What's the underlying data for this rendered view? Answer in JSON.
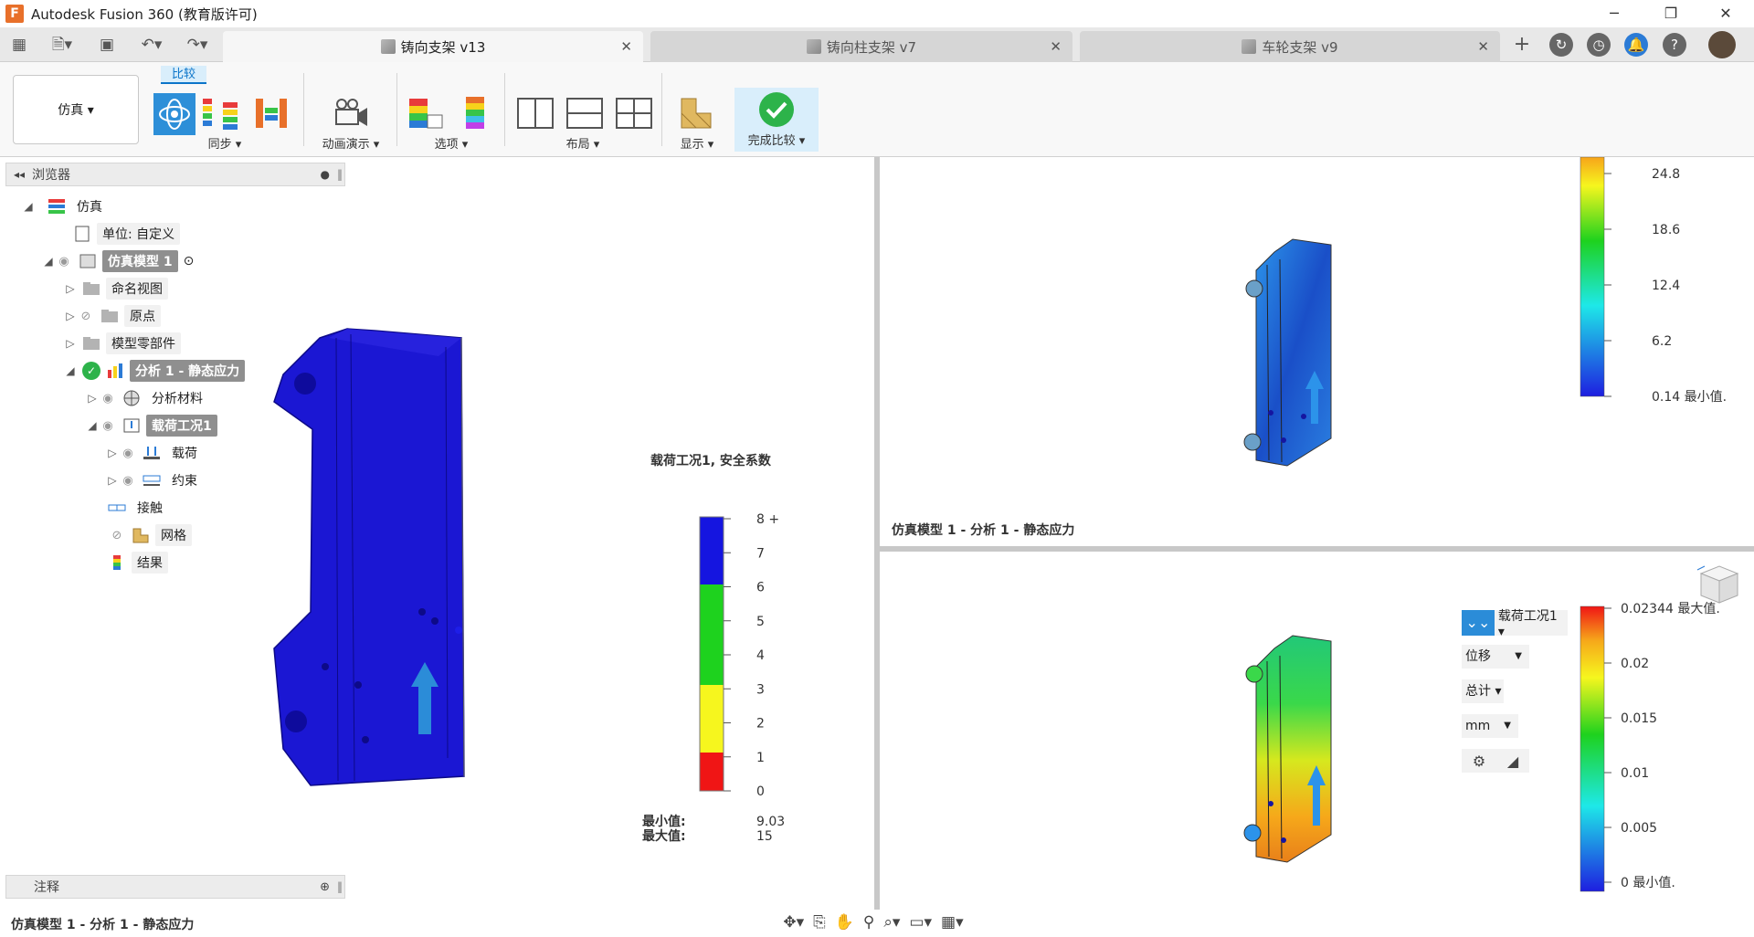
{
  "app": {
    "title": "Autodesk Fusion 360 (教育版许可)"
  },
  "tabs": [
    {
      "label": "铸向支架 v13",
      "active": true
    },
    {
      "label": "铸向柱支架 v7",
      "active": false
    },
    {
      "label": "车轮支架 v9",
      "active": false
    }
  ],
  "ribbon": {
    "workspace": "仿真 ▾",
    "compare_tab": "比较",
    "groups": {
      "sync": "同步 ▾",
      "animation": "动画演示 ▾",
      "options": "选项 ▾",
      "layout": "布局 ▾",
      "display": "显示 ▾",
      "finish": "完成比较 ▾"
    }
  },
  "browser": {
    "title": "浏览器",
    "items": [
      {
        "label": "仿真"
      },
      {
        "label": "单位: 自定义"
      },
      {
        "label": "仿真模型 1"
      },
      {
        "label": "命名视图"
      },
      {
        "label": "原点"
      },
      {
        "label": "模型零部件"
      },
      {
        "label": "分析 1 - 静态应力"
      },
      {
        "label": "分析材料"
      },
      {
        "label": "载荷工况1"
      },
      {
        "label": "载荷"
      },
      {
        "label": "约束"
      },
      {
        "label": "接触"
      },
      {
        "label": "网格"
      },
      {
        "label": "结果"
      }
    ]
  },
  "notes": {
    "title": "注释"
  },
  "status": {
    "left": "仿真模型 1 - 分析 1 - 静态应力"
  },
  "viewport_left": {
    "legend_title": "载荷工况1, 安全系数",
    "ticks": [
      "8 +",
      "7",
      "6",
      "5",
      "4",
      "3",
      "2",
      "1",
      "0"
    ],
    "min_label": "最小值:",
    "max_label": "最大值:",
    "min_value": "9.03",
    "max_value": "15"
  },
  "viewport_tr": {
    "ticks": [
      "24.8",
      "18.6",
      "12.4",
      "6.2",
      "0.14 最小值."
    ],
    "caption": "仿真模型 1 - 分析 1 - 静态应力"
  },
  "viewport_br": {
    "ticks": [
      "0.02344 最大值.",
      "0.02",
      "0.015",
      "0.01",
      "0.005",
      "0 最小值."
    ],
    "loadcase": "载荷工况1 ▾",
    "result_type": "位移",
    "component": "总计 ▾",
    "unit": "mm"
  },
  "colors": {
    "accent": "#0a74c9",
    "model_blue": "#1a1ad2",
    "finish_green": "#2db34a"
  }
}
